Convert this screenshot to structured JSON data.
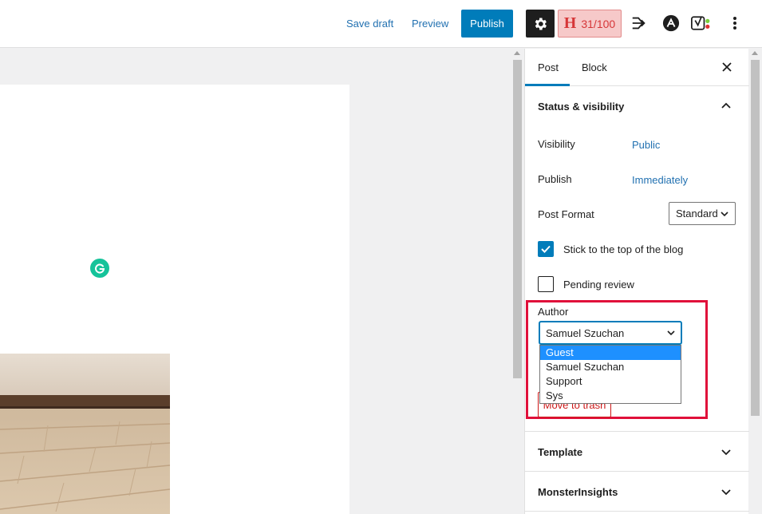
{
  "toolbar": {
    "save_draft": "Save draft",
    "preview": "Preview",
    "publish": "Publish",
    "seo_badge_letter": "H",
    "seo_score": "31/100",
    "settings_icon": "gear-icon",
    "more_icon": "vertical-ellipsis-icon"
  },
  "sidebar": {
    "tabs": {
      "post": "Post",
      "block": "Block"
    },
    "status": {
      "title": "Status & visibility",
      "visibility_label": "Visibility",
      "visibility_value": "Public",
      "publish_label": "Publish",
      "publish_value": "Immediately",
      "format_label": "Post Format",
      "format_value": "Standard",
      "sticky_label": "Stick to the top of the blog",
      "sticky_checked": true,
      "pending_label": "Pending review",
      "pending_checked": false,
      "author_label": "Author",
      "author_value": "Samuel Szuchan",
      "author_options": [
        "Guest",
        "Samuel Szuchan",
        "Support",
        "Sys"
      ],
      "author_highlighted": "Guest",
      "trash_label": "Move to trash"
    },
    "template_title": "Template",
    "monsterinsights_title": "MonsterInsights"
  },
  "colors": {
    "accent": "#007cba",
    "highlight_border": "#e0103a",
    "danger": "#cc1818"
  }
}
